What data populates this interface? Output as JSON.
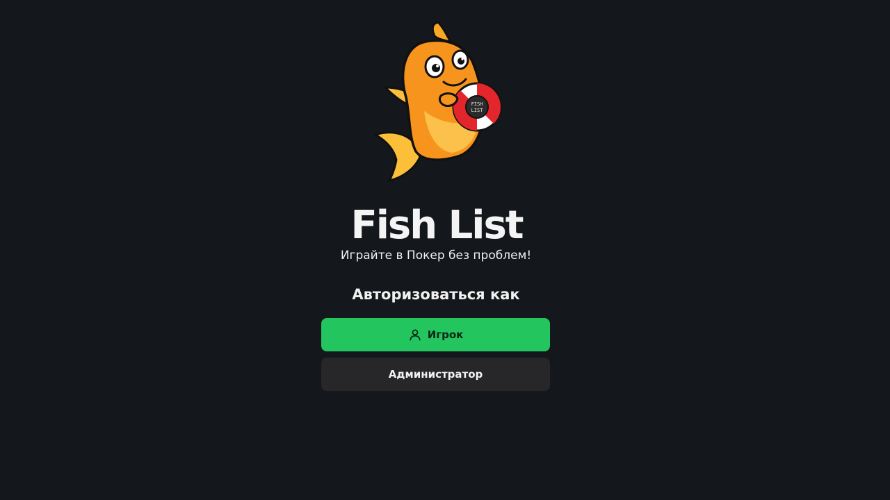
{
  "app": {
    "title": "Fish List",
    "tagline": "Играйте в Покер без проблем!",
    "logo_text_line1": "FISH",
    "logo_text_line2": "LIST"
  },
  "auth": {
    "heading": "Авторизоваться как",
    "player_button_label": "Игрок",
    "player_icon": "user-icon",
    "admin_button_label": "Администратор"
  },
  "colors": {
    "background": "#14171b",
    "primary_button": "#22c55e",
    "secondary_button": "#27272a",
    "fish_orange": "#f7941d",
    "ring_red": "#e3262b"
  }
}
